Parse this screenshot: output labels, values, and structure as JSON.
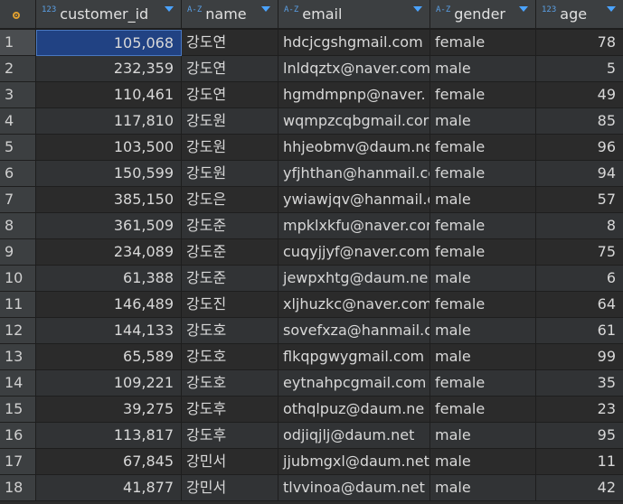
{
  "header": {
    "corner_icon": "settings-dot-icon",
    "columns": [
      {
        "type": "123",
        "label": "customer_id"
      },
      {
        "type": "A-Z",
        "label": "name"
      },
      {
        "type": "A-Z",
        "label": "email"
      },
      {
        "type": "A-Z",
        "label": "gender"
      },
      {
        "type": "123",
        "label": "age"
      }
    ]
  },
  "rows": [
    {
      "n": "1",
      "customer_id": "105,068",
      "name": "강도연",
      "email": "hdcjcgshgmail.com",
      "gender": "female",
      "age": "78"
    },
    {
      "n": "2",
      "customer_id": "232,359",
      "name": "강도연",
      "email": "lnldqztx@naver.com",
      "gender": "male",
      "age": "5"
    },
    {
      "n": "3",
      "customer_id": "110,461",
      "name": "강도연",
      "email": "hgmdmpnp@naver.",
      "gender": "female",
      "age": "49"
    },
    {
      "n": "4",
      "customer_id": "117,810",
      "name": "강도원",
      "email": "wqmpzcqbgmail.cor",
      "gender": "male",
      "age": "85"
    },
    {
      "n": "5",
      "customer_id": "103,500",
      "name": "강도원",
      "email": "hhjeobmv@daum.ne",
      "gender": "female",
      "age": "96"
    },
    {
      "n": "6",
      "customer_id": "150,599",
      "name": "강도원",
      "email": "yfjhthan@hanmail.cc",
      "gender": "female",
      "age": "94"
    },
    {
      "n": "7",
      "customer_id": "385,150",
      "name": "강도은",
      "email": "ywiawjqv@hanmail.c",
      "gender": "male",
      "age": "57"
    },
    {
      "n": "8",
      "customer_id": "361,509",
      "name": "강도준",
      "email": "mpklxkfu@naver.cor",
      "gender": "female",
      "age": "8"
    },
    {
      "n": "9",
      "customer_id": "234,089",
      "name": "강도준",
      "email": "cuqyjjyf@naver.com",
      "gender": "female",
      "age": "75"
    },
    {
      "n": "10",
      "customer_id": "61,388",
      "name": "강도준",
      "email": "jewpxhtg@daum.ne",
      "gender": "male",
      "age": "6"
    },
    {
      "n": "11",
      "customer_id": "146,489",
      "name": "강도진",
      "email": "xljhuzkc@naver.com",
      "gender": "female",
      "age": "64"
    },
    {
      "n": "12",
      "customer_id": "144,133",
      "name": "강도호",
      "email": "sovefxza@hanmail.c",
      "gender": "male",
      "age": "61"
    },
    {
      "n": "13",
      "customer_id": "65,589",
      "name": "강도호",
      "email": "flkqpgwygmail.com",
      "gender": "male",
      "age": "99"
    },
    {
      "n": "14",
      "customer_id": "109,221",
      "name": "강도호",
      "email": "eytnahpcgmail.com",
      "gender": "female",
      "age": "35"
    },
    {
      "n": "15",
      "customer_id": "39,275",
      "name": "강도후",
      "email": "othqlpuz@daum.ne",
      "gender": "female",
      "age": "23"
    },
    {
      "n": "16",
      "customer_id": "113,817",
      "name": "강도후",
      "email": "odjiqjlj@daum.net",
      "gender": "male",
      "age": "95"
    },
    {
      "n": "17",
      "customer_id": "67,845",
      "name": "강민서",
      "email": "jjubmgxl@daum.net",
      "gender": "male",
      "age": "11"
    },
    {
      "n": "18",
      "customer_id": "41,877",
      "name": "강민서",
      "email": "tlvvinoa@daum.net",
      "gender": "male",
      "age": "42"
    }
  ]
}
